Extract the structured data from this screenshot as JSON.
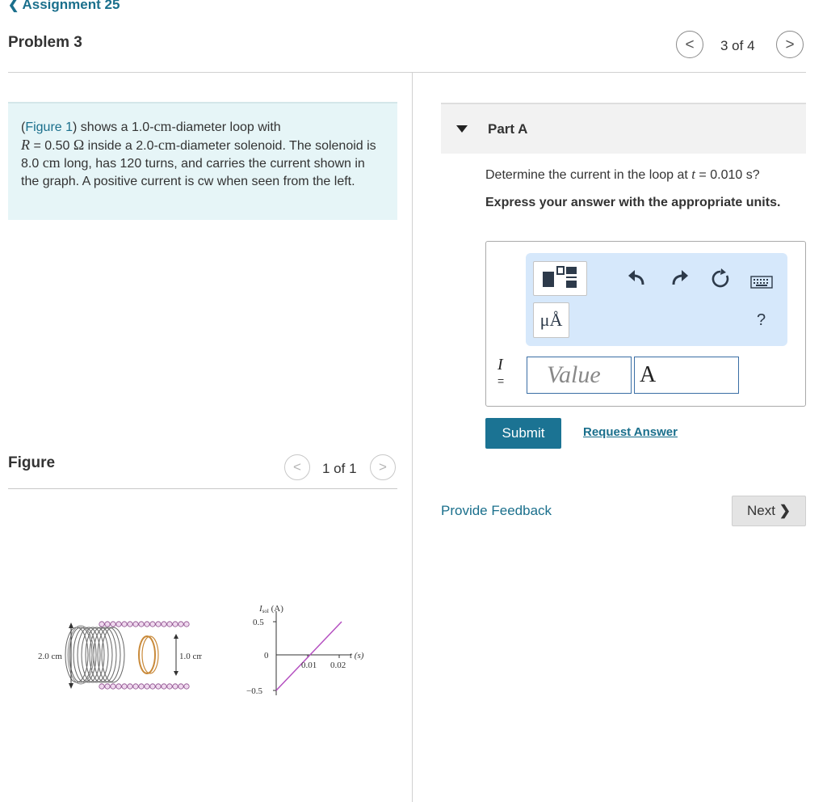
{
  "header": {
    "back_label": "Assignment 25",
    "problem_title": "Problem 3",
    "pager": "3 of 4",
    "prev_glyph": "<",
    "next_glyph": ">"
  },
  "problem": {
    "figure_link": "Figure 1",
    "p1": ") shows a 1.0-",
    "cm1": "cm",
    "p2": "-diameter loop with",
    "R": "R",
    "p3": " = 0.50 ",
    "omega": "Ω",
    "p4": " inside a 2.0-",
    "cm2": "cm",
    "p5": "-diameter solenoid. The solenoid is 8.0 ",
    "cm3": "cm",
    "p6": " long, has 120 turns, and carries the current shown in the graph. A positive current is cw when seen from the left."
  },
  "figure_panel": {
    "label": "Figure",
    "pager": "1 of 1",
    "solenoid": {
      "outer_label": "2.0 cm",
      "inner_label": "1.0 cm"
    },
    "graph": {
      "ylabel_var": "I",
      "ylabel_sub": "sol",
      "ylabel_unit": " (A)",
      "xlabel": "t (s)",
      "y_ticks": [
        "0.5",
        "0",
        "−0.5"
      ],
      "x_ticks": [
        "0.01",
        "0.02"
      ]
    }
  },
  "part_a": {
    "title": "Part A",
    "question_pre": "Determine the current in the loop at ",
    "question_var": "t",
    "question_post": " = 0.010 s?",
    "instruction": "Express your answer with the appropriate units.",
    "toolbar": {
      "fraction_icon": "fraction-template-icon",
      "units_label": "μÅ",
      "undo_icon": "undo-icon",
      "redo_icon": "redo-icon",
      "reset_icon": "reset-icon",
      "keyboard_icon": "keyboard-icon",
      "help_label": "?"
    },
    "variable": "I",
    "equals": "=",
    "value_placeholder": "Value",
    "unit_value": "A",
    "submit_label": "Submit",
    "request_label": "Request Answer"
  },
  "footer": {
    "feedback_label": "Provide Feedback",
    "next_label": "Next"
  },
  "colors": {
    "accent": "#1b7393",
    "link": "#1a6f8c",
    "problem_bg": "#e6f5f7",
    "toolbar_bg": "#d6e8fb",
    "graph_line": "#b44fc0",
    "loop": "#c98a3a"
  }
}
